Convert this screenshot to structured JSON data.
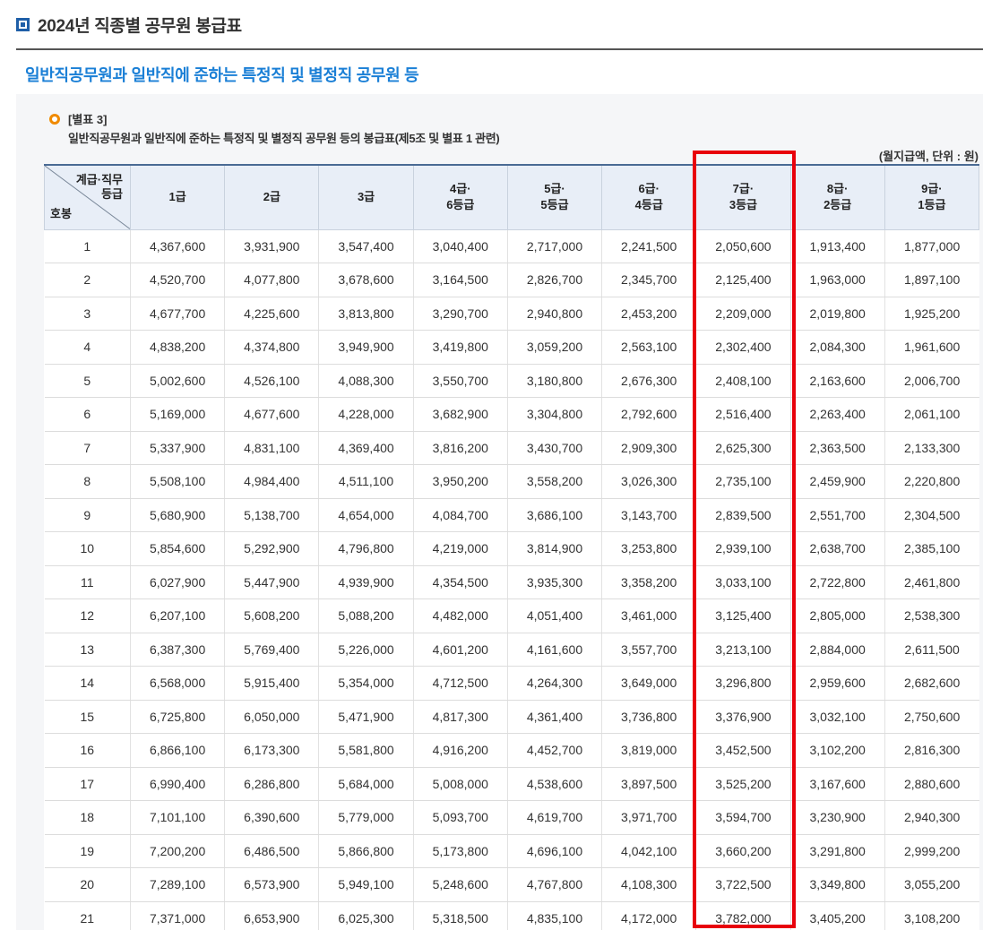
{
  "page_title": "2024년 직종별 공무원 봉급표",
  "section_title": "일반직공무원과 일반직에 준하는 특정직 및 별정직 공무원 등",
  "note_label": "[별표 3]",
  "note_desc": "일반직공무원과 일반직에 준하는 특정직 및 별정직 공무원 등의 봉급표(제5조 및 별표 1 관련)",
  "unit": "(월지급액, 단위 : 원)",
  "table": {
    "corner_top": "계급·직무\n등급",
    "corner_bottom": "호봉",
    "columns": [
      "1급",
      "2급",
      "3급",
      "4급·\n6등급",
      "5급·\n5등급",
      "6급·\n4등급",
      "7급·\n3등급",
      "8급·\n2등급",
      "9급·\n1등급"
    ],
    "rows": [
      [
        "1",
        "4,367,600",
        "3,931,900",
        "3,547,400",
        "3,040,400",
        "2,717,000",
        "2,241,500",
        "2,050,600",
        "1,913,400",
        "1,877,000"
      ],
      [
        "2",
        "4,520,700",
        "4,077,800",
        "3,678,600",
        "3,164,500",
        "2,826,700",
        "2,345,700",
        "2,125,400",
        "1,963,000",
        "1,897,100"
      ],
      [
        "3",
        "4,677,700",
        "4,225,600",
        "3,813,800",
        "3,290,700",
        "2,940,800",
        "2,453,200",
        "2,209,000",
        "2,019,800",
        "1,925,200"
      ],
      [
        "4",
        "4,838,200",
        "4,374,800",
        "3,949,900",
        "3,419,800",
        "3,059,200",
        "2,563,100",
        "2,302,400",
        "2,084,300",
        "1,961,600"
      ],
      [
        "5",
        "5,002,600",
        "4,526,100",
        "4,088,300",
        "3,550,700",
        "3,180,800",
        "2,676,300",
        "2,408,100",
        "2,163,600",
        "2,006,700"
      ],
      [
        "6",
        "5,169,000",
        "4,677,600",
        "4,228,000",
        "3,682,900",
        "3,304,800",
        "2,792,600",
        "2,516,400",
        "2,263,400",
        "2,061,100"
      ],
      [
        "7",
        "5,337,900",
        "4,831,100",
        "4,369,400",
        "3,816,200",
        "3,430,700",
        "2,909,300",
        "2,625,300",
        "2,363,500",
        "2,133,300"
      ],
      [
        "8",
        "5,508,100",
        "4,984,400",
        "4,511,100",
        "3,950,200",
        "3,558,200",
        "3,026,300",
        "2,735,100",
        "2,459,900",
        "2,220,800"
      ],
      [
        "9",
        "5,680,900",
        "5,138,700",
        "4,654,000",
        "4,084,700",
        "3,686,100",
        "3,143,700",
        "2,839,500",
        "2,551,700",
        "2,304,500"
      ],
      [
        "10",
        "5,854,600",
        "5,292,900",
        "4,796,800",
        "4,219,000",
        "3,814,900",
        "3,253,800",
        "2,939,100",
        "2,638,700",
        "2,385,100"
      ],
      [
        "11",
        "6,027,900",
        "5,447,900",
        "4,939,900",
        "4,354,500",
        "3,935,300",
        "3,358,200",
        "3,033,100",
        "2,722,800",
        "2,461,800"
      ],
      [
        "12",
        "6,207,100",
        "5,608,200",
        "5,088,200",
        "4,482,000",
        "4,051,400",
        "3,461,000",
        "3,125,400",
        "2,805,000",
        "2,538,300"
      ],
      [
        "13",
        "6,387,300",
        "5,769,400",
        "5,226,000",
        "4,601,200",
        "4,161,600",
        "3,557,700",
        "3,213,100",
        "2,884,000",
        "2,611,500"
      ],
      [
        "14",
        "6,568,000",
        "5,915,400",
        "5,354,000",
        "4,712,500",
        "4,264,300",
        "3,649,000",
        "3,296,800",
        "2,959,600",
        "2,682,600"
      ],
      [
        "15",
        "6,725,800",
        "6,050,000",
        "5,471,900",
        "4,817,300",
        "4,361,400",
        "3,736,800",
        "3,376,900",
        "3,032,100",
        "2,750,600"
      ],
      [
        "16",
        "6,866,100",
        "6,173,300",
        "5,581,800",
        "4,916,200",
        "4,452,700",
        "3,819,000",
        "3,452,500",
        "3,102,200",
        "2,816,300"
      ],
      [
        "17",
        "6,990,400",
        "6,286,800",
        "5,684,000",
        "5,008,000",
        "4,538,600",
        "3,897,500",
        "3,525,200",
        "3,167,600",
        "2,880,600"
      ],
      [
        "18",
        "7,101,100",
        "6,390,600",
        "5,779,000",
        "5,093,700",
        "4,619,700",
        "3,971,700",
        "3,594,700",
        "3,230,900",
        "2,940,300"
      ],
      [
        "19",
        "7,200,200",
        "6,486,500",
        "5,866,800",
        "5,173,800",
        "4,696,100",
        "4,042,100",
        "3,660,200",
        "3,291,800",
        "2,999,200"
      ],
      [
        "20",
        "7,289,100",
        "6,573,900",
        "5,949,100",
        "5,248,600",
        "4,767,800",
        "4,108,300",
        "3,722,500",
        "3,349,800",
        "3,055,200"
      ],
      [
        "21",
        "7,371,000",
        "6,653,900",
        "6,025,300",
        "5,318,500",
        "4,835,100",
        "4,172,000",
        "3,782,000",
        "3,405,200",
        "3,108,200"
      ]
    ]
  },
  "highlight_color": "#e8000b"
}
